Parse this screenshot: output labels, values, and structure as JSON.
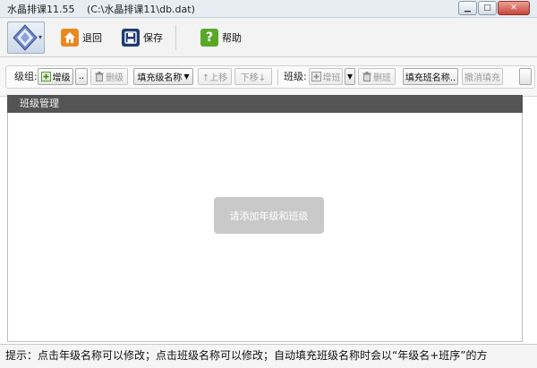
{
  "window": {
    "app_title": "水晶排课11.55",
    "file_path": "(C:\\水晶排课11\\db.dat)",
    "minimize_glyph": "▁",
    "maximize_glyph": "□",
    "close_glyph": "✕"
  },
  "main_toolbar": {
    "back_label": "退回",
    "save_label": "保存",
    "help_label": "帮助"
  },
  "grade_bar": {
    "label": "级组:",
    "add_label": "增级",
    "more_label": "..",
    "delete_label": "删级",
    "fill_label": "填充级名称",
    "move_up_label": "↑上移",
    "move_down_label": "下移↓"
  },
  "class_bar": {
    "label": "班级:",
    "add_label": "增班",
    "delete_label": "删班",
    "fill_label": "填充班名称..",
    "cancel_fill_label": "撤消填充"
  },
  "panel": {
    "title": "班级管理",
    "empty_message": "请添加年级和班级"
  },
  "status": {
    "hint": "提示：点击年级名称可以修改；点击班级名称可以修改；自动填充班级名称时会以“年级名+班序”的方"
  },
  "colors": {
    "panel_header": "#545454",
    "empty_box": "#c9c9c9",
    "back_icon": "#e8891f",
    "save_icon": "#1e3a73",
    "help_icon": "#5aa829"
  },
  "icons": {
    "logo": "diamond-logo-icon",
    "back": "home-icon",
    "save": "floppy-disk-icon",
    "help": "question-mark-icon",
    "add": "add-item-icon",
    "delete": "trash-icon",
    "dropdown": "caret-down-icon"
  }
}
